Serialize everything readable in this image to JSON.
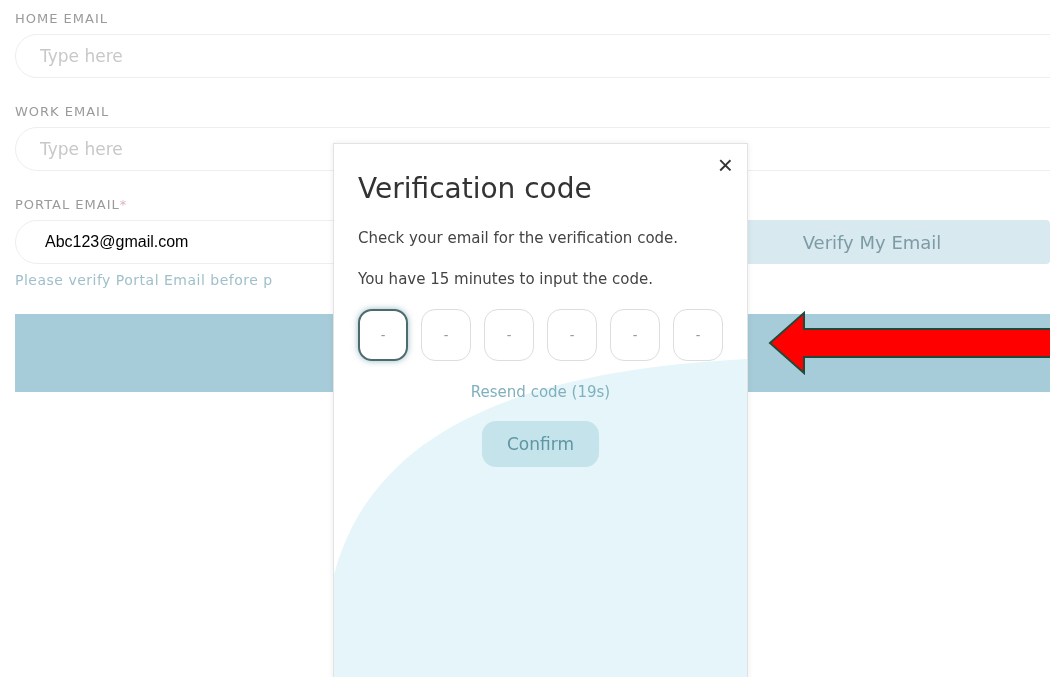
{
  "form": {
    "fields": [
      {
        "label": "HOME EMAIL",
        "placeholder": "Type here"
      },
      {
        "label": "WORK EMAIL",
        "placeholder": "Type here"
      }
    ],
    "portal": {
      "label": "PORTAL EMAIL",
      "required_mark": "*",
      "value": "Abc123@gmail.com",
      "verify_button": "Verify My Email",
      "hint": "Please verify Portal Email before p"
    }
  },
  "dialog": {
    "title": "Verification code",
    "close": "×",
    "lines": [
      "Check your email for the verification code.",
      "You have 15 minutes to input the code."
    ],
    "code_boxes": [
      {
        "placeholder": "-",
        "focused": true
      },
      {
        "placeholder": "-",
        "focused": false
      },
      {
        "placeholder": "-",
        "focused": false
      },
      {
        "placeholder": "-",
        "focused": false
      },
      {
        "placeholder": "-",
        "focused": false
      },
      {
        "placeholder": "-",
        "focused": false
      }
    ],
    "resend": "Resend code (19s)",
    "confirm": {
      "label": "Confirm",
      "disabled": true
    }
  }
}
